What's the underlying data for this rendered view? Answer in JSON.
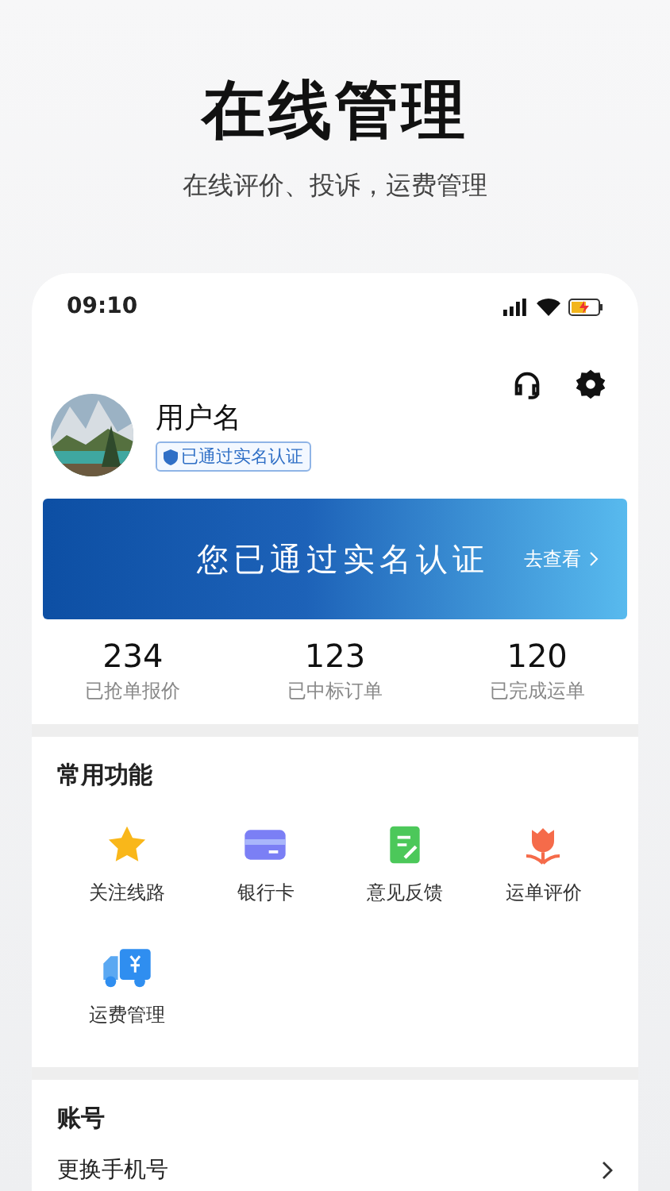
{
  "header": {
    "title": "在线管理",
    "subtitle": "在线评价、投诉，运费管理"
  },
  "status_bar": {
    "time": "09:10"
  },
  "profile": {
    "username": "用户名",
    "badge": "已通过实名认证"
  },
  "banner": {
    "text": "您已通过实名认证",
    "link": "去查看"
  },
  "stats": [
    {
      "value": "234",
      "label": "已抢单报价"
    },
    {
      "value": "123",
      "label": "已中标订单"
    },
    {
      "value": "120",
      "label": "已完成运单"
    }
  ],
  "functions": {
    "title": "常用功能",
    "items": [
      {
        "kind": "star",
        "label": "关注线路"
      },
      {
        "kind": "card",
        "label": "银行卡"
      },
      {
        "kind": "feedback",
        "label": "意见反馈"
      },
      {
        "kind": "flower",
        "label": "运单评价"
      },
      {
        "kind": "truck",
        "label": "运费管理"
      }
    ]
  },
  "account": {
    "title": "账号",
    "rows": [
      {
        "label": "更换手机号"
      }
    ]
  }
}
